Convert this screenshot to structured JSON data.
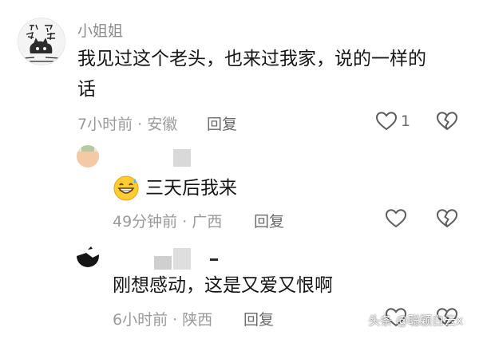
{
  "comments": [
    {
      "username": "小姐姐",
      "text_line1": "我见过这个老头，也来过我家，说的一样的",
      "text_line2": "话",
      "time": "7小时前",
      "location": "安徽",
      "reply_label": "回复",
      "like_count": "1"
    },
    {
      "text": "三天后我来",
      "time": "49分钟前",
      "location": "广西",
      "reply_label": "回复"
    },
    {
      "text": "刚想感动，这是又爱又恨啊",
      "time": "6小时前",
      "location": "陕西",
      "reply_label": "回复"
    }
  ],
  "meta_separator": "·",
  "watermark": "头条 @聪颖白云x",
  "icons": {
    "like": "heart-outline-icon",
    "dislike": "broken-heart-icon",
    "emoji": "grinning-sweat-emoji"
  }
}
